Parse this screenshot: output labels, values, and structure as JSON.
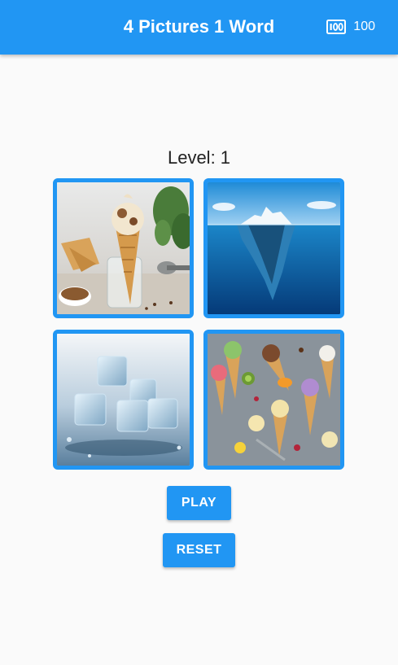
{
  "app": {
    "title": "4 Pictures 1 Word",
    "coins": "100"
  },
  "level": {
    "label": "Level: 1"
  },
  "tiles": [
    {
      "icon": "ice-cream-cone-photo"
    },
    {
      "icon": "iceberg-photo"
    },
    {
      "icon": "ice-cubes-photo"
    },
    {
      "icon": "ice-cream-cones-photo"
    }
  ],
  "buttons": {
    "play": "PLAY",
    "reset": "RESET"
  },
  "colors": {
    "primary": "#2196f3",
    "background": "#fafafa"
  }
}
